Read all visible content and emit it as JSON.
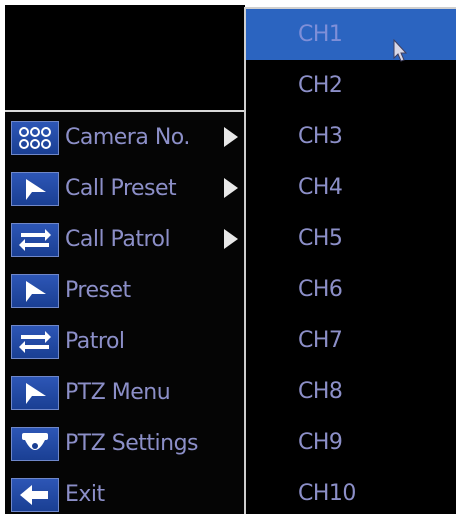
{
  "ptz_menu": {
    "items": [
      {
        "label": "Camera No.",
        "icon": "camera-grid-icon",
        "has_submenu": true
      },
      {
        "label": "Call Preset",
        "icon": "play-arrow-icon",
        "has_submenu": true
      },
      {
        "label": "Call Patrol",
        "icon": "swap-arrows-icon",
        "has_submenu": true
      },
      {
        "label": "Preset",
        "icon": "play-arrow-icon",
        "has_submenu": false
      },
      {
        "label": "Patrol",
        "icon": "swap-arrows-icon",
        "has_submenu": false
      },
      {
        "label": "PTZ Menu",
        "icon": "play-arrow-icon",
        "has_submenu": false
      },
      {
        "label": "PTZ Settings",
        "icon": "dome-camera-icon",
        "has_submenu": false
      },
      {
        "label": "Exit",
        "icon": "back-arrow-icon",
        "has_submenu": false
      }
    ]
  },
  "channel_menu": {
    "selected": "CH1",
    "items": [
      "CH1",
      "CH2",
      "CH3",
      "CH4",
      "CH5",
      "CH6",
      "CH7",
      "CH8",
      "CH9",
      "CH10"
    ]
  },
  "colors": {
    "menu_text": "#8c8fc8",
    "selected_bg": "#2b64c0",
    "icon_bg": "#2d56b6",
    "background": "#000000"
  }
}
